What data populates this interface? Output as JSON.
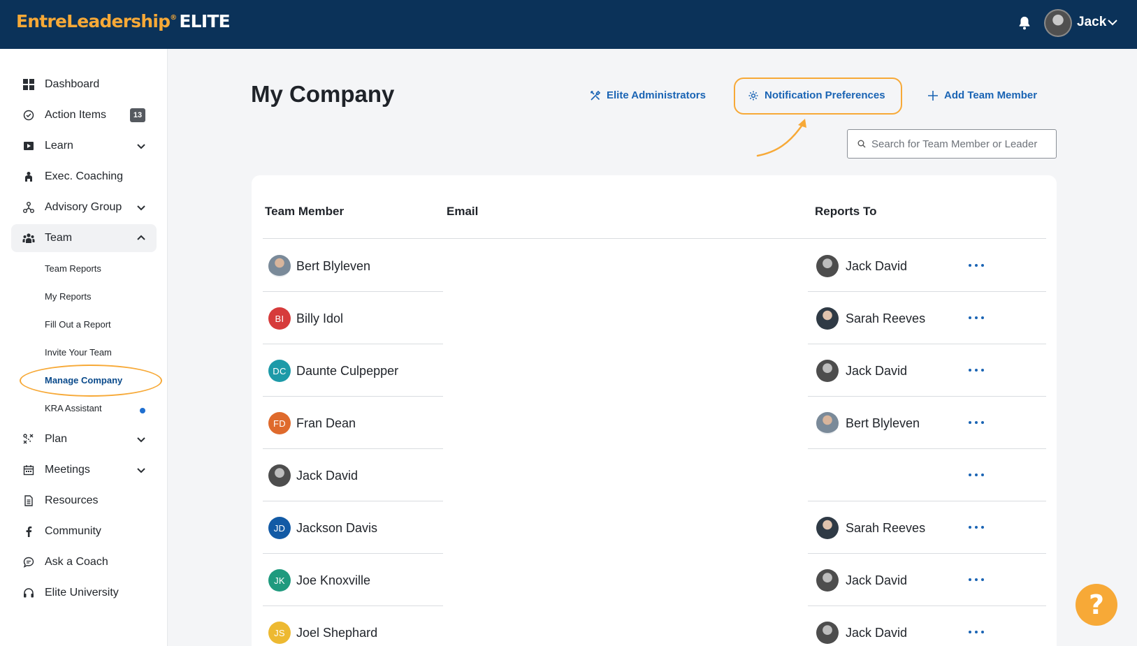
{
  "header": {
    "brand": "EntreLeadership",
    "brand_suffix": "ELITE",
    "user_name": "Jack",
    "icons": [
      "bell-icon",
      "chevron-down-icon"
    ],
    "colors": {
      "bar": "#0b3259",
      "accent": "#f7a937",
      "link": "#1a64b4"
    }
  },
  "sidebar": {
    "items": [
      {
        "label": "Dashboard",
        "icon": "grid-icon"
      },
      {
        "label": "Action Items",
        "icon": "check-circle-icon",
        "badge": "13"
      },
      {
        "label": "Learn",
        "icon": "play-icon",
        "expandable": true
      },
      {
        "label": "Exec. Coaching",
        "icon": "coaching-icon"
      },
      {
        "label": "Advisory Group",
        "icon": "network-icon",
        "expandable": true
      },
      {
        "label": "Team",
        "icon": "team-icon",
        "expanded": true
      }
    ],
    "team_sub": [
      "Team Reports",
      "My Reports",
      "Fill Out a Report",
      "Invite Your Team",
      "Manage Company",
      "KRA Assistant"
    ],
    "items_after": [
      {
        "label": "Plan",
        "icon": "plan-icon",
        "expandable": true
      },
      {
        "label": "Meetings",
        "icon": "calendar-icon",
        "expandable": true
      },
      {
        "label": "Resources",
        "icon": "document-icon"
      },
      {
        "label": "Community",
        "icon": "facebook-icon"
      },
      {
        "label": "Ask a Coach",
        "icon": "chat-icon"
      },
      {
        "label": "Elite University",
        "icon": "headset-icon"
      }
    ]
  },
  "main": {
    "title": "My Company",
    "links": {
      "admins": "Elite Administrators",
      "notifications": "Notification Preferences",
      "add_member": "Add Team Member"
    },
    "search": {
      "placeholder": "Search for Team Member or Leader"
    },
    "table": {
      "columns": [
        "Team Member",
        "Email",
        "Reports To"
      ],
      "rows": [
        {
          "name": "Bert Blyleven",
          "initials": "",
          "email": "",
          "reports_to": "Jack David"
        },
        {
          "name": "Billy Idol",
          "initials": "BI",
          "email": "",
          "reports_to": "Sarah Reeves"
        },
        {
          "name": "Daunte Culpepper",
          "initials": "DC",
          "email": "",
          "reports_to": "Jack David"
        },
        {
          "name": "Fran Dean",
          "initials": "FD",
          "email": "",
          "reports_to": "Bert Blyleven"
        },
        {
          "name": "Jack David",
          "initials": "",
          "email": "",
          "reports_to": ""
        },
        {
          "name": "Jackson Davis",
          "initials": "JD",
          "email": "",
          "reports_to": "Sarah Reeves"
        },
        {
          "name": "Joe Knoxville",
          "initials": "JK",
          "email": "",
          "reports_to": "Jack David"
        },
        {
          "name": "Joel Shephard",
          "initials": "JS",
          "email": "",
          "reports_to": "Jack David"
        }
      ],
      "initial_colors": {
        "BI": "#d63b3b",
        "DC": "#1d9aa8",
        "FD": "#df6a2c",
        "JD": "#125aa5",
        "JK": "#1f9a7e",
        "JS": "#edb931"
      }
    },
    "help_button": "?"
  }
}
